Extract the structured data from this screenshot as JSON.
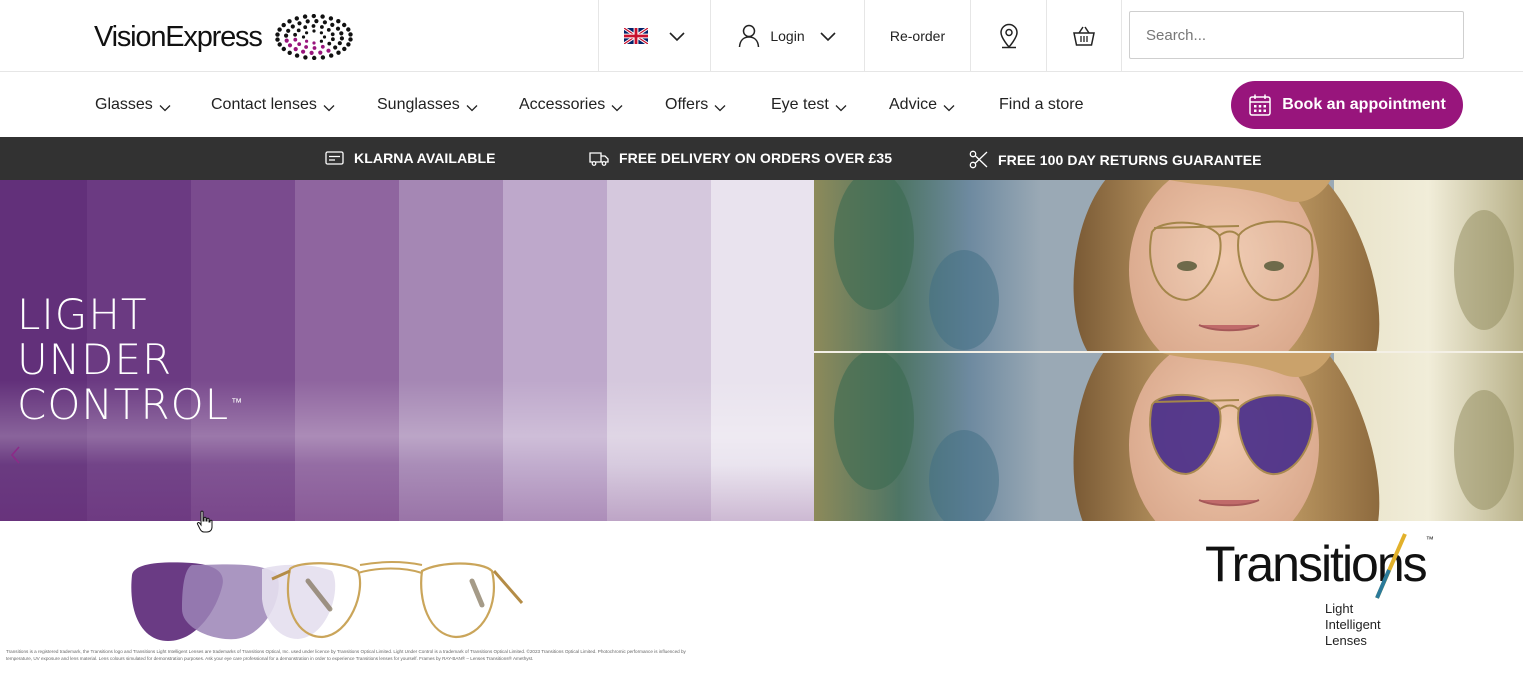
{
  "header": {
    "brand": "VisionExpress",
    "login_label": "Login",
    "reorder_label": "Re-order",
    "search_placeholder": "Search..."
  },
  "nav": {
    "items": [
      {
        "label": "Glasses",
        "has_dropdown": true
      },
      {
        "label": "Contact lenses",
        "has_dropdown": true
      },
      {
        "label": "Sunglasses",
        "has_dropdown": true
      },
      {
        "label": "Accessories",
        "has_dropdown": true
      },
      {
        "label": "Offers",
        "has_dropdown": true
      },
      {
        "label": "Eye test",
        "has_dropdown": true
      },
      {
        "label": "Advice",
        "has_dropdown": true
      },
      {
        "label": "Find a store",
        "has_dropdown": false
      }
    ],
    "book_label": "Book an appointment"
  },
  "infobar": {
    "items": [
      {
        "label": "KLARNA AVAILABLE",
        "icon": "card-icon"
      },
      {
        "label": "FREE DELIVERY ON ORDERS OVER £35",
        "icon": "truck-icon"
      },
      {
        "label": "FREE 100 DAY RETURNS GUARANTEE",
        "icon": "scissors-icon"
      }
    ]
  },
  "hero": {
    "title_lines": [
      "LIGHT",
      "UNDER",
      "CONTROL"
    ],
    "title_tm": "™"
  },
  "promo": {
    "brand": "Transitions",
    "brand_tm": "™",
    "tagline_lines": [
      "Light",
      "Intelligent",
      "Lenses"
    ],
    "fine_print": "Transitions is a registered trademark, the Transitions logo and Transitions Light Intelligent Lenses are trademarks of Transitions Optical, Inc. used under licence by Transitions Optical Limited. Light Under Control is a trademark of Transitions Optical Limited. ©2023 Transitions Optical Limited. Photochromic performance is influenced by temperature, UV exposure and lens material. Lens colours simulated for demonstration purposes. Ask your eye care professional for a demonstration in order to experience Transitions lenses for yourself. Frames by RAY-BAN® – Lenses Transitions® Amethyst."
  },
  "colors": {
    "brand_purple": "#98157c",
    "infobar_bg": "#323232"
  }
}
